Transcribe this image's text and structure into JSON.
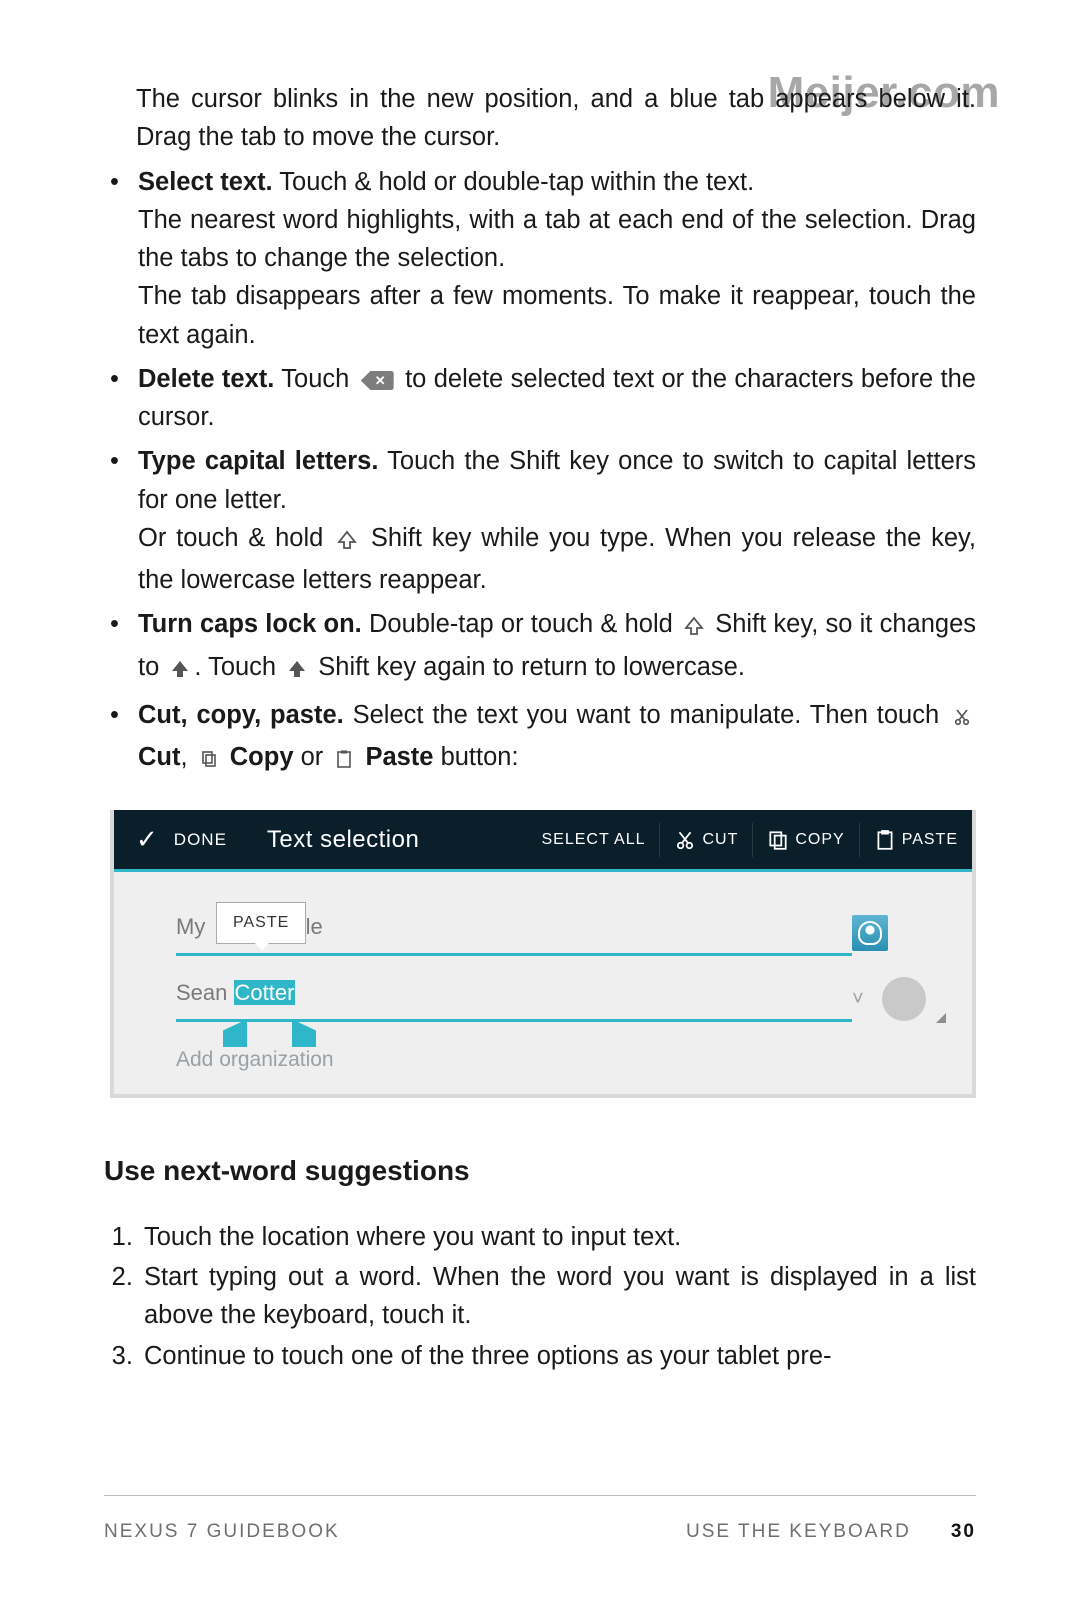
{
  "watermark": "Meijer.com",
  "intro": "The cursor blinks in the new position, and a blue tab appears below it. Drag the tab to move the cursor.",
  "bullets": {
    "select_lead": "Select text.",
    "select_body1": " Touch & hold or double-tap within the text.",
    "select_body2": "The nearest word highlights, with a tab at each end of the selection. Drag the tabs to change the selection.",
    "select_body3": "The tab disappears after a few moments. To make it reappear, touch the text again.",
    "delete_lead": "Delete text.",
    "delete_body1": " Touch ",
    "delete_body2": " to delete selected text or the characters before the cursor.",
    "backspace_glyph": "✕",
    "caps_lead": "Type capital letters.",
    "caps_body1": " Touch the Shift key once to switch to capital letters for one letter.",
    "caps_body2a": "Or touch & hold ",
    "caps_body2b": " Shift key while you type. When you release the key, the lowercase letters reappear.",
    "lock_lead": "Turn caps lock on.",
    "lock_body1a": " Double-tap or touch & hold ",
    "lock_body1b": " Shift key, so it changes to ",
    "lock_body1c": ". Touch ",
    "lock_body1d": " Shift key again to return to lowercase.",
    "ccp_lead": "Cut, copy, paste.",
    "ccp_body1": " Select the text you want to manipulate. Then touch ",
    "ccp_cut": "Cut",
    "ccp_comma": ", ",
    "ccp_copy": "Copy",
    "ccp_or": " or ",
    "ccp_paste": "Paste",
    "ccp_end": " button:"
  },
  "toolbar": {
    "done": "DONE",
    "title": "Text selection",
    "select_all": "SELECT ALL",
    "cut": "CUT",
    "copy": "COPY",
    "paste": "PASTE",
    "check": "✓"
  },
  "editor": {
    "row1_prefix": "My ",
    "row1_suffix": "le",
    "paste_popup": "PASTE",
    "row2_prefix": "Sean ",
    "row2_sel": "Cotter",
    "add_org": "Add organization",
    "chev": "˅"
  },
  "section_title": "Use next-word suggestions",
  "numbered": {
    "i1": "Touch the location where you want to input text.",
    "i2": "Start typing out a word. When the word you want is displayed in a list above the keyboard, touch it.",
    "i3": "Continue to touch one of the three options as your tablet pre-"
  },
  "footer": {
    "left": "NEXUS 7 GUIDEBOOK",
    "right": "USE THE KEYBOARD",
    "page": "30"
  }
}
